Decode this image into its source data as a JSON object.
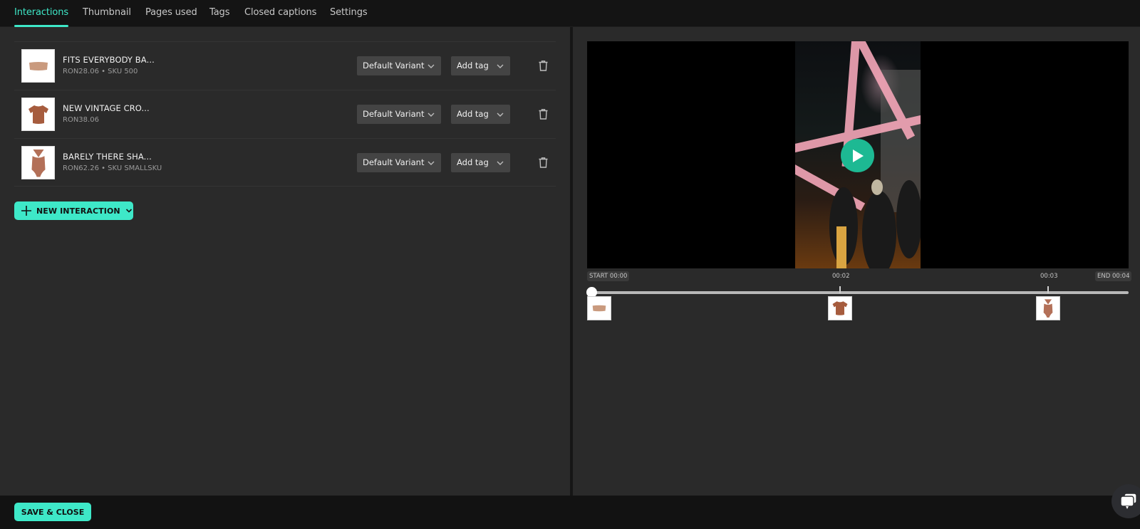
{
  "tabs": [
    {
      "label": "Interactions",
      "active": true
    },
    {
      "label": "Thumbnail",
      "active": false
    },
    {
      "label": "Pages used",
      "active": false
    },
    {
      "label": "Tags",
      "active": false
    },
    {
      "label": "Closed captions",
      "active": false
    },
    {
      "label": "Settings",
      "active": false
    }
  ],
  "interactions": [
    {
      "name": "FITS EVERYBODY BA...",
      "meta": "RON28.06 • SKU 500",
      "variant": "Default Variant",
      "tag": "Add tag",
      "thumb_icon": "bandeau-top-icon"
    },
    {
      "name": "NEW VINTAGE CRO...",
      "meta": "RON38.06",
      "variant": "Default Variant",
      "tag": "Add tag",
      "thumb_icon": "crop-tshirt-icon"
    },
    {
      "name": "BARELY THERE SHA...",
      "meta": "RON62.26 • SKU SMALLSKU",
      "variant": "Default Variant",
      "tag": "Add tag",
      "thumb_icon": "bodysuit-icon"
    }
  ],
  "new_interaction_label": "NEW INTERACTION",
  "video": {
    "play_icon": "play-icon"
  },
  "timeline": {
    "start_label": "START 00:00",
    "end_label": "END 00:04",
    "duration_s": 4,
    "playhead_s": 0,
    "markers": [
      {
        "time_label": "00:02",
        "time_s": 2.2,
        "product": "crop-tshirt"
      },
      {
        "time_label": "00:03",
        "time_s": 3.42,
        "product": "bodysuit"
      }
    ],
    "start_product": "bandeau-top"
  },
  "footer": {
    "save_label": "SAVE & CLOSE"
  },
  "colors": {
    "accent": "#3ee8c8",
    "play": "#1db993",
    "panel": "#2a2a2a",
    "product": "#b8735a"
  }
}
